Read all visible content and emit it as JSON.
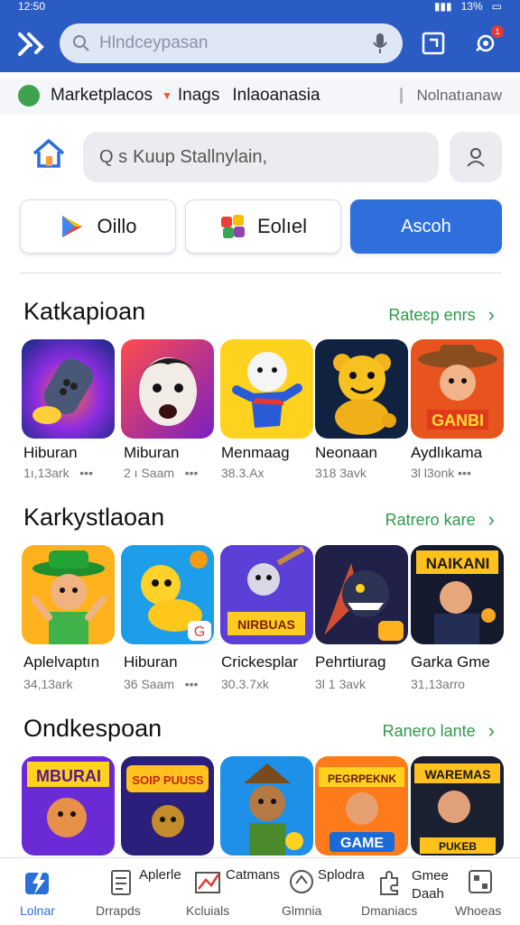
{
  "status_bar": {
    "time": "12:50",
    "battery": "13%"
  },
  "top_search": {
    "placeholder": "Hlndceypasan"
  },
  "notification_badge": "1",
  "filters": {
    "item1": "Marketplacos",
    "item2": "Inags",
    "item3": "Inlaoanasia",
    "right": "Nolnatıanaw"
  },
  "search2": {
    "placeholder": "Kuup Stallnylain,",
    "prefix": "Q s"
  },
  "chips": {
    "chip1": "Oillo",
    "chip2": "Eolıel",
    "chip3": "Ascoh"
  },
  "sections": [
    {
      "title": "Katkapioan",
      "link": "Rateɛp enrs",
      "apps": [
        {
          "name": "Hiburan",
          "meta": "1ı,13ark",
          "icon": "rocket-icon"
        },
        {
          "name": "Miburan",
          "meta": "2 ı Saam",
          "icon": "face-icon"
        },
        {
          "name": "Menmaag",
          "meta": "38.3.Ax",
          "icon": "dog-icon"
        },
        {
          "name": "Neonaan",
          "meta": "318 3avk",
          "icon": "bear-icon"
        },
        {
          "name": "Aydlıkama",
          "meta": "3l l3onk",
          "icon": "cowboy-icon"
        }
      ]
    },
    {
      "title": "Karkystlaoan",
      "link": "Ratrero kare",
      "apps": [
        {
          "name": "Aplelvaptın",
          "meta": "34,13ark",
          "icon": "hat-icon"
        },
        {
          "name": "Hiburan",
          "meta": "36 Saam",
          "icon": "duck-icon"
        },
        {
          "name": "Crickesplar",
          "meta": "30.3.7xk",
          "icon": "warrior-icon"
        },
        {
          "name": "Pehrtiurag",
          "meta": "3l 1 3avk",
          "icon": "monster-icon"
        },
        {
          "name": "Garka Gme",
          "meta": "31,13arro",
          "icon": "player-icon"
        }
      ]
    },
    {
      "title": "Ondkespoan",
      "link": "Ranero lante",
      "apps": [
        {
          "name": "",
          "meta": "",
          "icon": "bear-icon"
        },
        {
          "name": "",
          "meta": "",
          "icon": "robot-icon"
        },
        {
          "name": "",
          "meta": "",
          "icon": "hunter-icon"
        },
        {
          "name": "",
          "meta": "",
          "icon": "game-icon"
        },
        {
          "name": "",
          "meta": "",
          "icon": "hero-icon"
        }
      ]
    }
  ],
  "tile_texts": {
    "s1t5": "GANBI",
    "s2t3": "NIRBUAS",
    "s2t5": "NAIKANI",
    "s3t1": "MBURAI",
    "s3t2": "SOIP PUUSS",
    "s3t4a": "PEGRPEKNK",
    "s3t4b": "GAME",
    "s3t5a": "WAREMAS",
    "s3t5b": "PUKEB"
  },
  "bottom_nav": [
    {
      "label": "Lolnar",
      "top": ""
    },
    {
      "label": "Drrapds",
      "top": "Aplerle"
    },
    {
      "label": "Kcluials",
      "top": "Catmans"
    },
    {
      "label": "Glmnia",
      "top": "Splodra"
    },
    {
      "label": "Dmaniacs",
      "top": "Gmee Daah"
    },
    {
      "label": "Whoeas",
      "top": ""
    }
  ],
  "colors": {
    "brand": "#2b5cc4",
    "accent_green": "#2e9a4a",
    "primary_button": "#2e6fdc"
  }
}
